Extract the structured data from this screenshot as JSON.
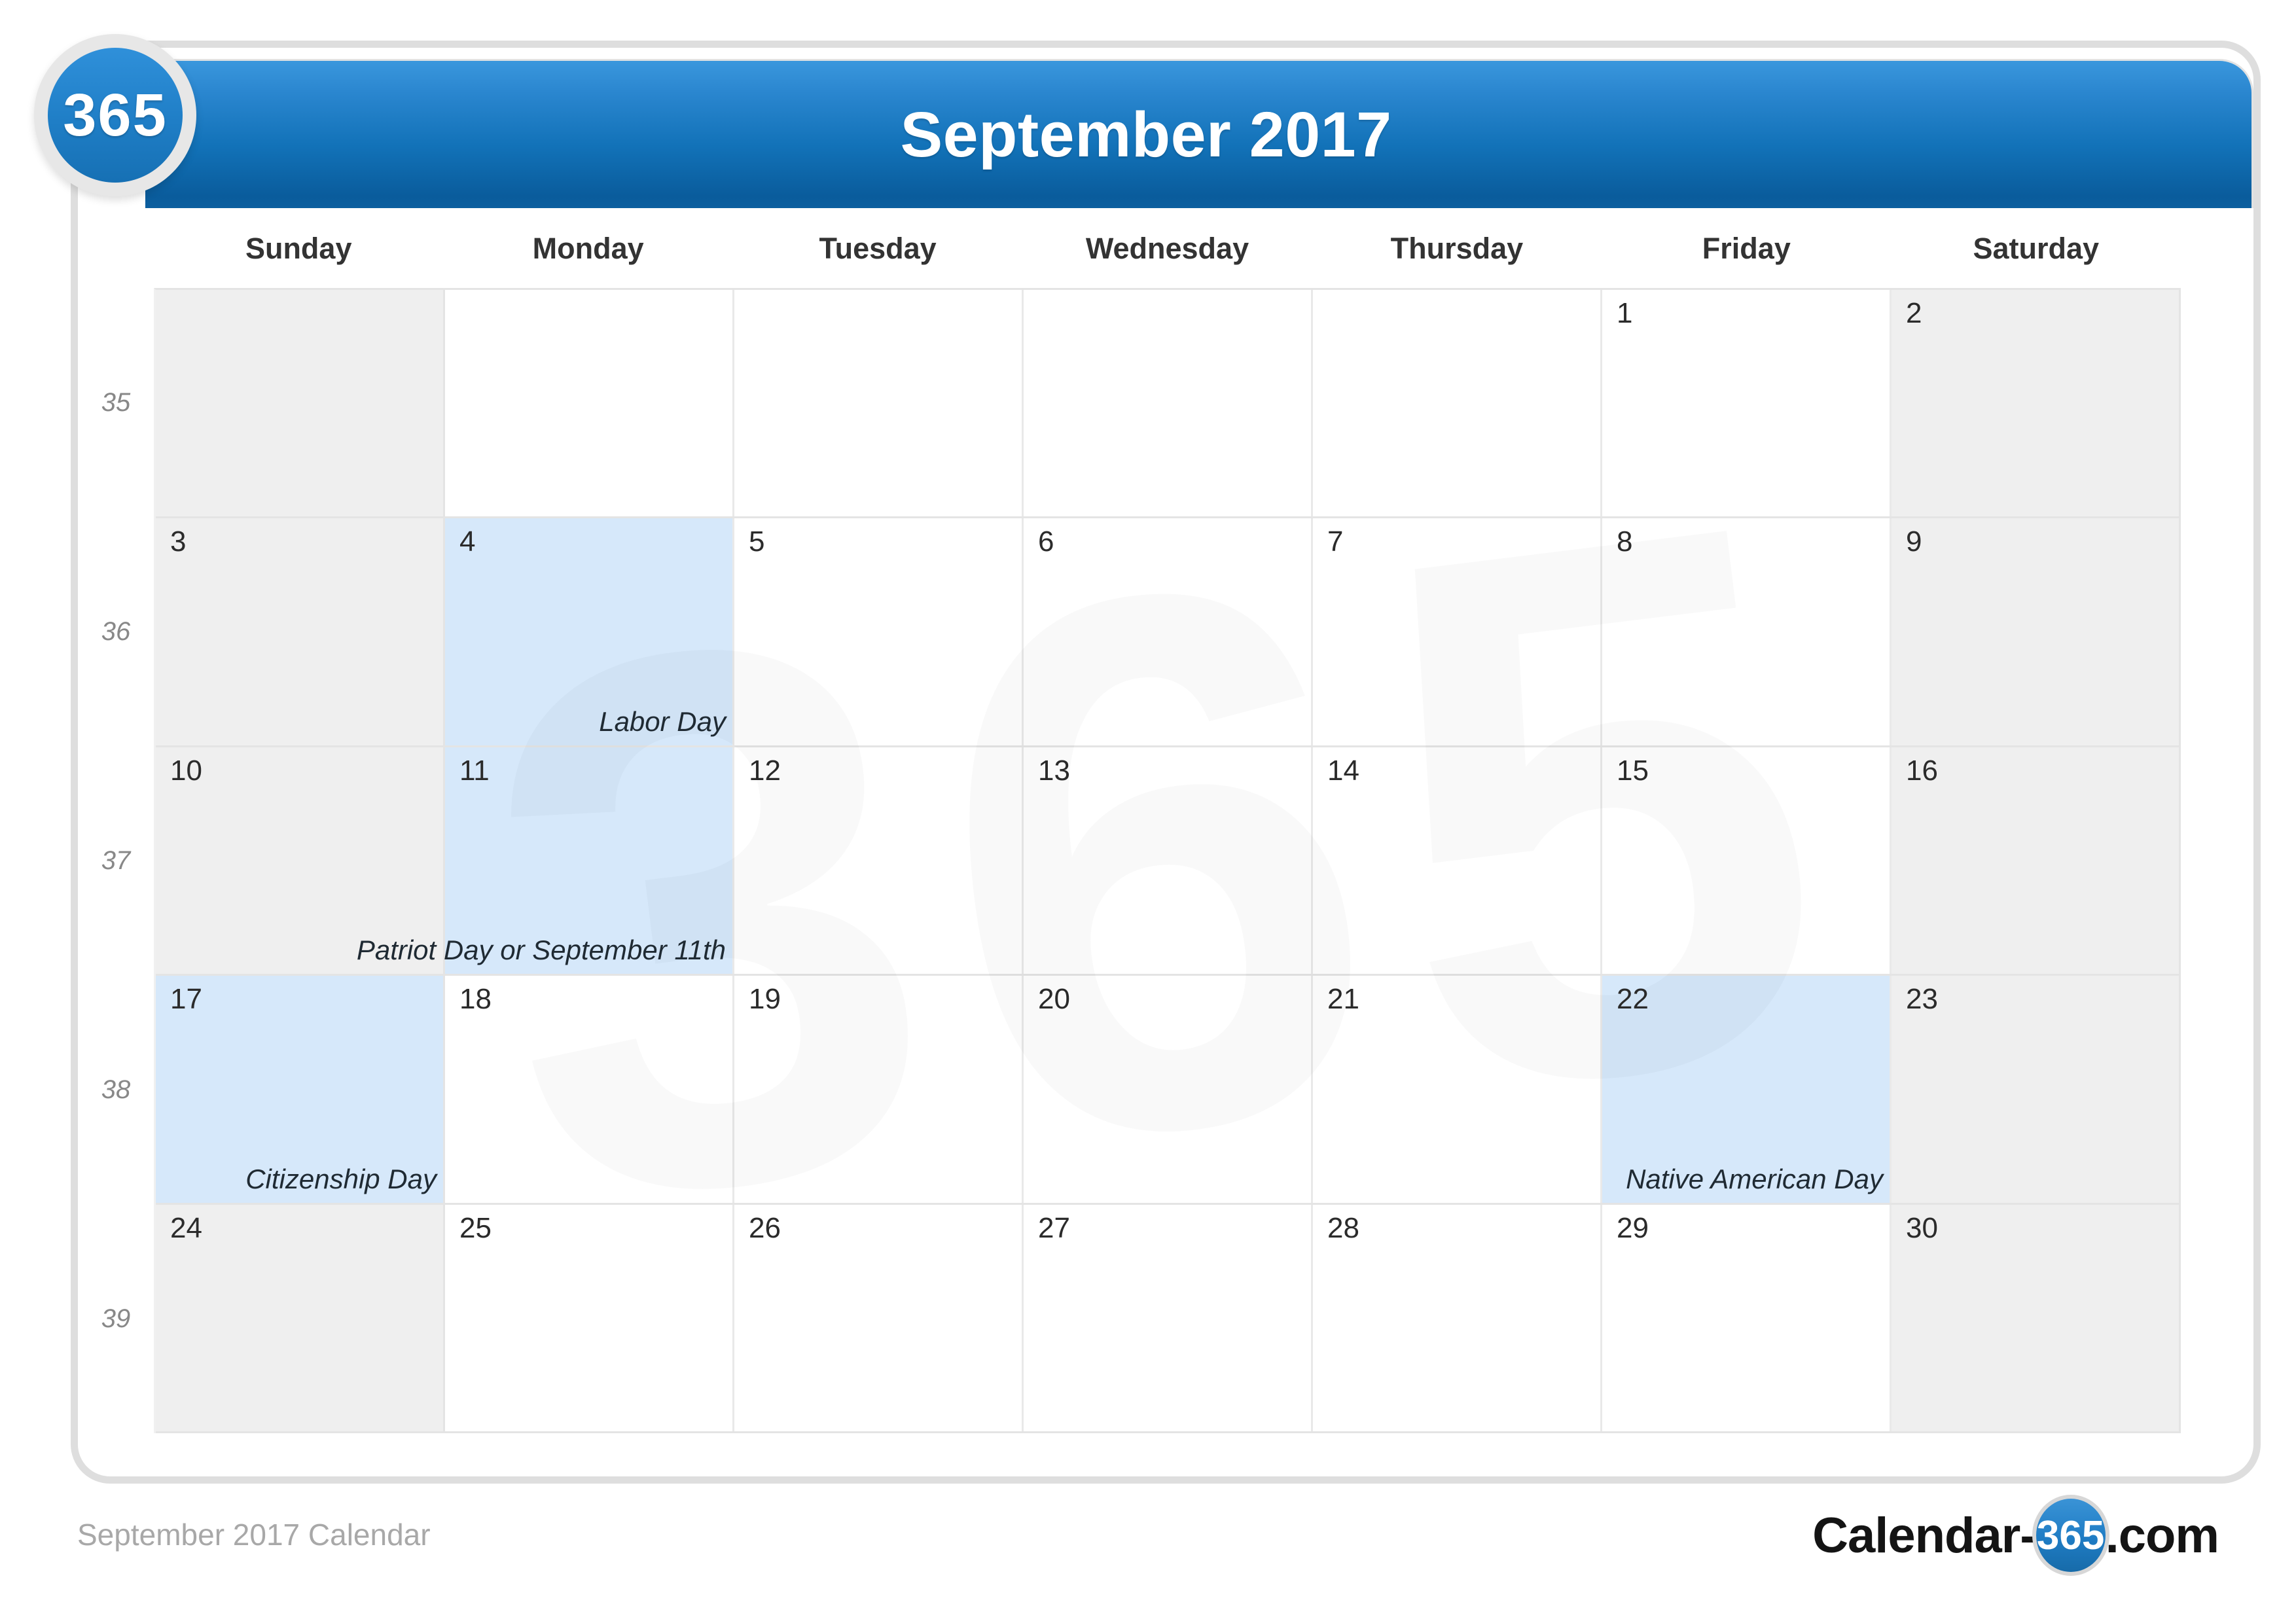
{
  "brand": {
    "badge_text": "365",
    "logo_prefix": "Calendar-",
    "logo_circle": "365",
    "logo_suffix": ".com",
    "watermark_text": "365",
    "accent_blue": "#1f7ec6",
    "header_gradient_top": "#3a97dd",
    "header_gradient_bottom": "#0a5c9c",
    "holiday_highlight": "#d6e8fa",
    "weekend_bg": "#efefef"
  },
  "header": {
    "title": "September 2017"
  },
  "footer": {
    "caption": "September 2017 Calendar"
  },
  "calendar": {
    "weekdays": [
      "Sunday",
      "Monday",
      "Tuesday",
      "Wednesday",
      "Thursday",
      "Friday",
      "Saturday"
    ],
    "week_numbers": [
      "35",
      "36",
      "37",
      "38",
      "39"
    ],
    "weeks": [
      {
        "number": "35",
        "days": [
          {
            "num": "",
            "event": "",
            "weekend": true,
            "holiday": false,
            "blank": true
          },
          {
            "num": "",
            "event": "",
            "weekend": false,
            "holiday": false,
            "blank": true
          },
          {
            "num": "",
            "event": "",
            "weekend": false,
            "holiday": false,
            "blank": true
          },
          {
            "num": "",
            "event": "",
            "weekend": false,
            "holiday": false,
            "blank": true
          },
          {
            "num": "",
            "event": "",
            "weekend": false,
            "holiday": false,
            "blank": true
          },
          {
            "num": "1",
            "event": "",
            "weekend": false,
            "holiday": false,
            "blank": false
          },
          {
            "num": "2",
            "event": "",
            "weekend": true,
            "holiday": false,
            "blank": false
          }
        ]
      },
      {
        "number": "36",
        "days": [
          {
            "num": "3",
            "event": "",
            "weekend": true,
            "holiday": false,
            "blank": false
          },
          {
            "num": "4",
            "event": "Labor Day",
            "weekend": false,
            "holiday": true,
            "blank": false
          },
          {
            "num": "5",
            "event": "",
            "weekend": false,
            "holiday": false,
            "blank": false
          },
          {
            "num": "6",
            "event": "",
            "weekend": false,
            "holiday": false,
            "blank": false
          },
          {
            "num": "7",
            "event": "",
            "weekend": false,
            "holiday": false,
            "blank": false
          },
          {
            "num": "8",
            "event": "",
            "weekend": false,
            "holiday": false,
            "blank": false
          },
          {
            "num": "9",
            "event": "",
            "weekend": true,
            "holiday": false,
            "blank": false
          }
        ]
      },
      {
        "number": "37",
        "days": [
          {
            "num": "10",
            "event": "",
            "weekend": true,
            "holiday": false,
            "blank": false
          },
          {
            "num": "11",
            "event": "Patriot Day or September 11th",
            "weekend": false,
            "holiday": true,
            "blank": false
          },
          {
            "num": "12",
            "event": "",
            "weekend": false,
            "holiday": false,
            "blank": false
          },
          {
            "num": "13",
            "event": "",
            "weekend": false,
            "holiday": false,
            "blank": false
          },
          {
            "num": "14",
            "event": "",
            "weekend": false,
            "holiday": false,
            "blank": false
          },
          {
            "num": "15",
            "event": "",
            "weekend": false,
            "holiday": false,
            "blank": false
          },
          {
            "num": "16",
            "event": "",
            "weekend": true,
            "holiday": false,
            "blank": false
          }
        ]
      },
      {
        "number": "38",
        "days": [
          {
            "num": "17",
            "event": "Citizenship Day",
            "weekend": true,
            "holiday": true,
            "blank": false
          },
          {
            "num": "18",
            "event": "",
            "weekend": false,
            "holiday": false,
            "blank": false
          },
          {
            "num": "19",
            "event": "",
            "weekend": false,
            "holiday": false,
            "blank": false
          },
          {
            "num": "20",
            "event": "",
            "weekend": false,
            "holiday": false,
            "blank": false
          },
          {
            "num": "21",
            "event": "",
            "weekend": false,
            "holiday": false,
            "blank": false
          },
          {
            "num": "22",
            "event": "Native American Day",
            "weekend": false,
            "holiday": true,
            "blank": false
          },
          {
            "num": "23",
            "event": "",
            "weekend": true,
            "holiday": false,
            "blank": false
          }
        ]
      },
      {
        "number": "39",
        "days": [
          {
            "num": "24",
            "event": "",
            "weekend": true,
            "holiday": false,
            "blank": false
          },
          {
            "num": "25",
            "event": "",
            "weekend": false,
            "holiday": false,
            "blank": false
          },
          {
            "num": "26",
            "event": "",
            "weekend": false,
            "holiday": false,
            "blank": false
          },
          {
            "num": "27",
            "event": "",
            "weekend": false,
            "holiday": false,
            "blank": false
          },
          {
            "num": "28",
            "event": "",
            "weekend": false,
            "holiday": false,
            "blank": false
          },
          {
            "num": "29",
            "event": "",
            "weekend": false,
            "holiday": false,
            "blank": false
          },
          {
            "num": "30",
            "event": "",
            "weekend": true,
            "holiday": false,
            "blank": false
          }
        ]
      }
    ]
  }
}
